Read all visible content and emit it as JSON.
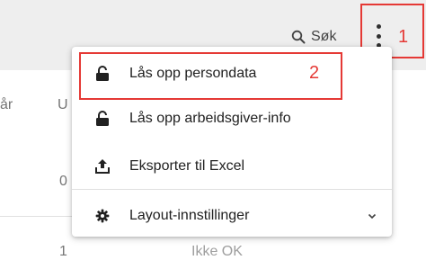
{
  "toolbar": {
    "search_label": "Søk"
  },
  "background": {
    "column_header_fragment": "år",
    "column_header_u": "U",
    "cell_0": "0",
    "cell_1": "1",
    "status_text": "Ikke OK"
  },
  "menu": {
    "items": [
      {
        "label": "Lås opp persondata",
        "icon": "lock-open-icon"
      },
      {
        "label": "Lås opp arbeidsgiver-info",
        "icon": "lock-open-icon"
      },
      {
        "label": "Eksporter til Excel",
        "icon": "export-icon"
      },
      {
        "label": "Layout-innstillinger",
        "icon": "gear-icon"
      }
    ]
  },
  "annotations": {
    "label_1": "1",
    "label_2": "2"
  },
  "colors": {
    "annotation": "#e53935",
    "toolbar_bg": "#eeeeee",
    "text": "#212121"
  }
}
